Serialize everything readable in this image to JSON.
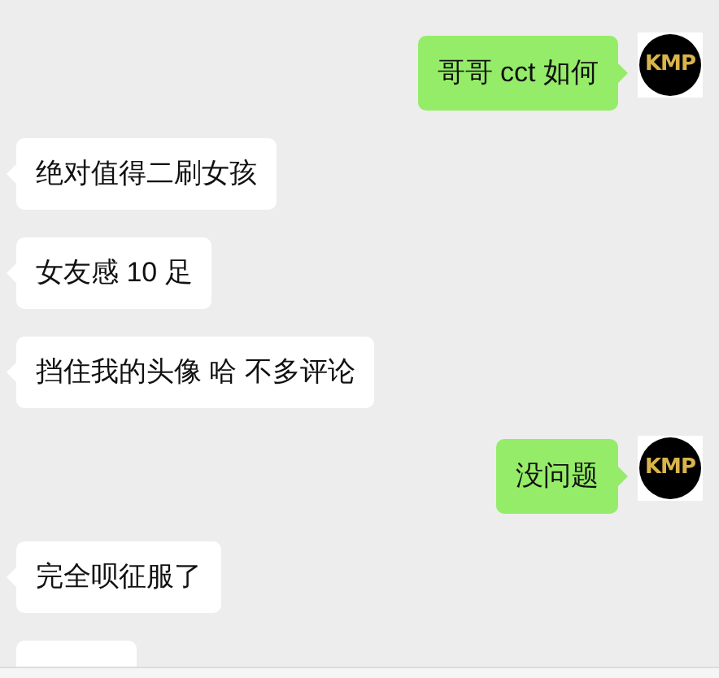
{
  "messages": [
    {
      "kind": "sent",
      "text": "哥哥 cct 如何",
      "avatar": "KMP"
    },
    {
      "kind": "received",
      "text": "绝对值得二刷女孩"
    },
    {
      "kind": "received",
      "text": "女友感 10 足"
    },
    {
      "kind": "received",
      "text": "挡住我的头像 哈 不多评论"
    },
    {
      "kind": "sent",
      "text": "没问题",
      "avatar": "KMP"
    },
    {
      "kind": "received",
      "text": "完全呗征服了"
    },
    {
      "kind": "partial"
    }
  ]
}
